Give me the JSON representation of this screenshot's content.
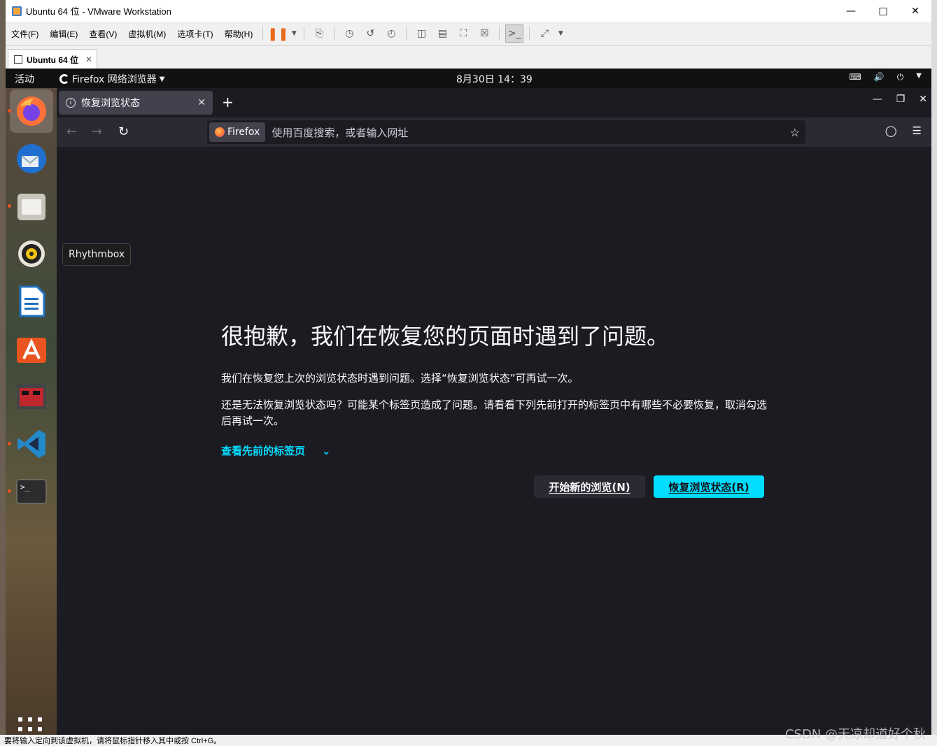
{
  "vmware": {
    "window_title": "Ubuntu 64 位 - VMware Workstation",
    "menu": [
      "文件(F)",
      "编辑(E)",
      "查看(V)",
      "虚拟机(M)",
      "选项卡(T)",
      "帮助(H)"
    ],
    "tab_label": "Ubuntu 64 位",
    "status_text": "要将输入定向到该虚拟机，请将鼠标指针移入其中或按 Ctrl+G。"
  },
  "ubuntu": {
    "activities": "活动",
    "app_name": "Firefox 网络浏览器",
    "clock": "8月30日  14：39",
    "tooltip": "Rhythmbox"
  },
  "firefox": {
    "tab_title": "恢复浏览状态",
    "url_chip": "Firefox",
    "url_placeholder": "使用百度搜索，或者输入网址"
  },
  "page": {
    "title": "很抱歉，我们在恢复您的页面时遇到了问题。",
    "p1": "我们在恢复您上次的浏览状态时遇到问题。选择“恢复浏览状态”可再试一次。",
    "p2": "还是无法恢复浏览状态吗？可能某个标签页造成了问题。请看看下列先前打开的标签页中有哪些不必要恢复，取消勾选后再试一次。",
    "view_tabs": "查看先前的标签页",
    "btn_new": "开始新的浏览(N)",
    "btn_restore": "恢复浏览状态(R)"
  },
  "watermark": "CSDN @天凉却道好个秋"
}
